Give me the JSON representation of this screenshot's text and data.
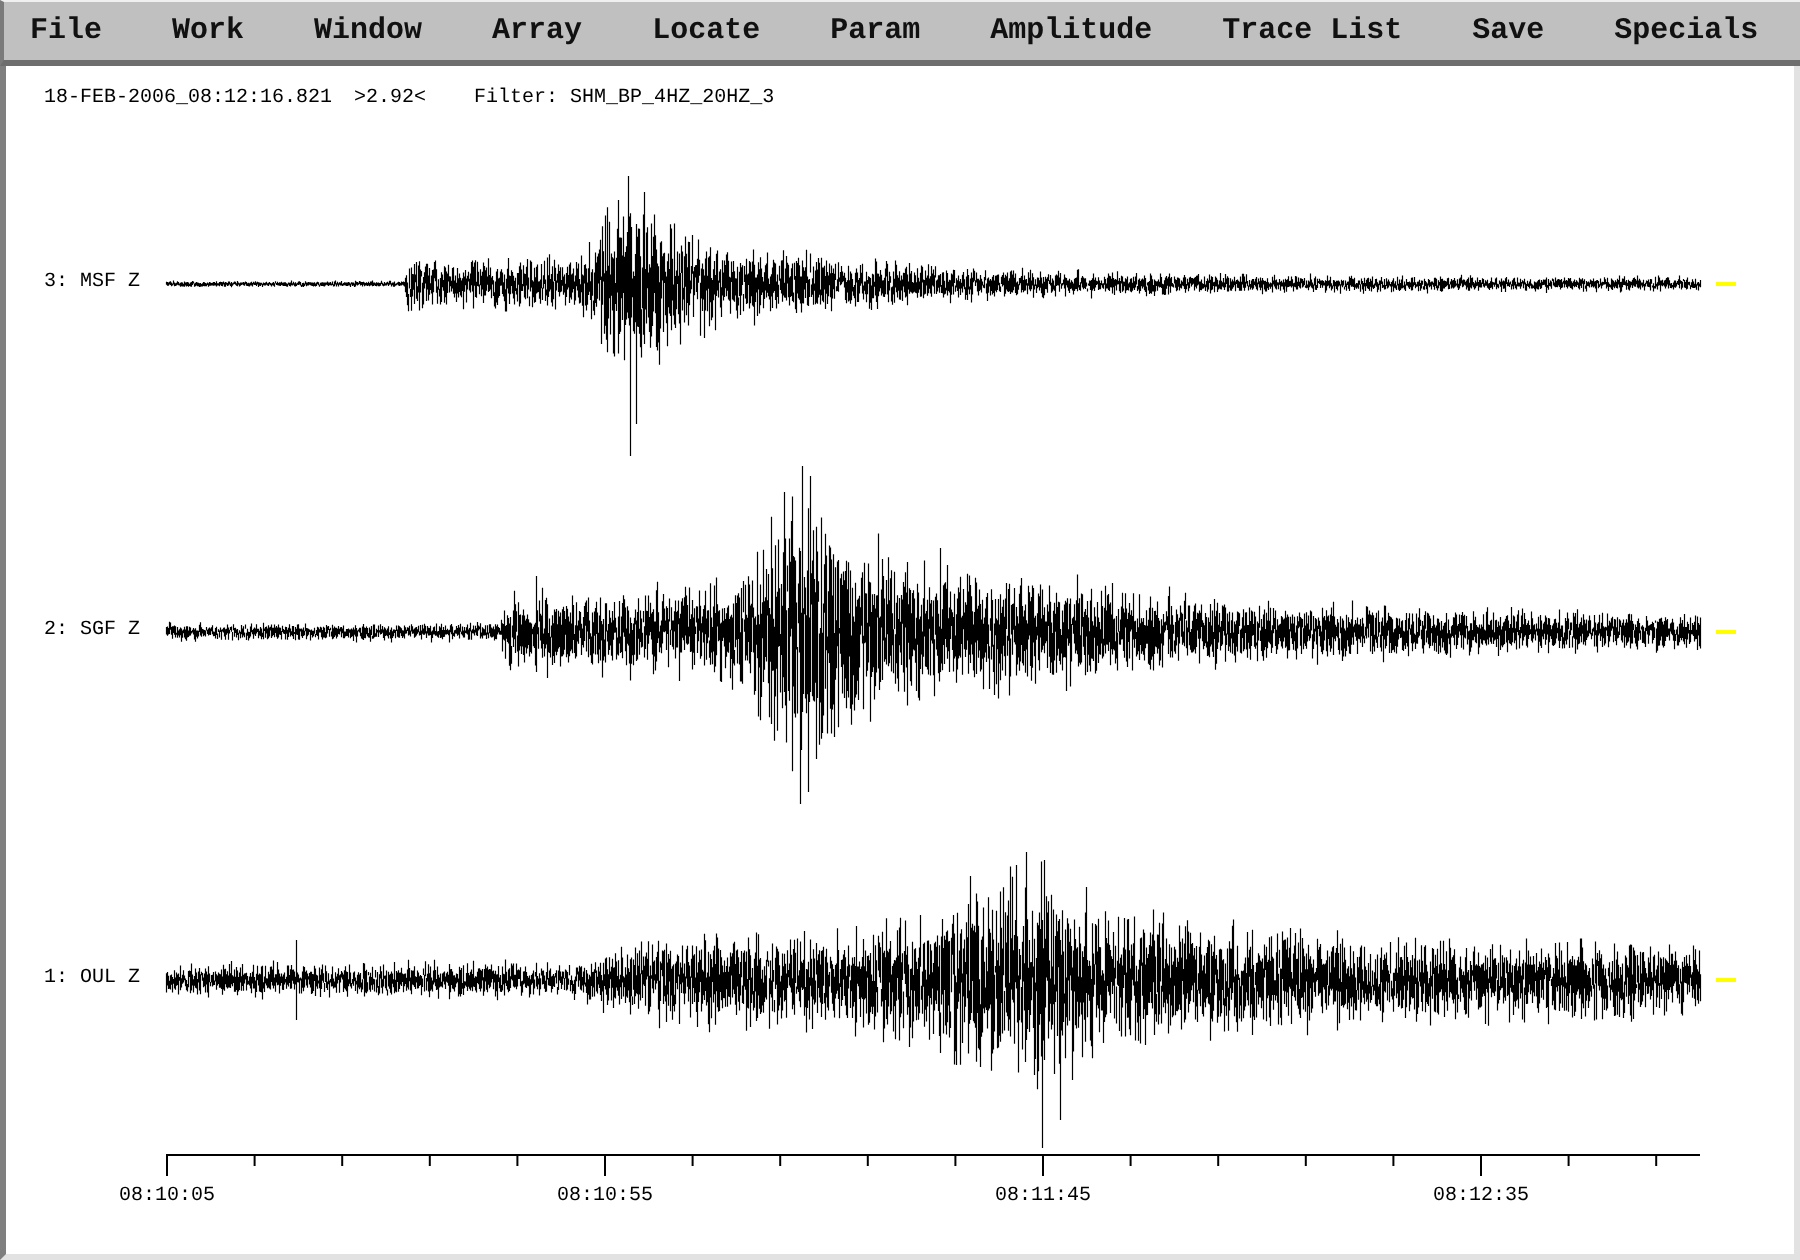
{
  "menu": [
    "File",
    "Work",
    "Window",
    "Array",
    "Locate",
    "Param",
    "Amplitude",
    "Trace List",
    "Save",
    "Specials"
  ],
  "header": {
    "timestamp": "18-FEB-2006_08:12:16.821",
    "amplitude": ">2.92<",
    "filter": "Filter: SHM_BP_4HZ_20HZ_3"
  },
  "traces": [
    {
      "label": "3: MSF Z"
    },
    {
      "label": "2: SGF Z"
    },
    {
      "label": "1: OUL Z"
    }
  ],
  "time_axis": {
    "labels": [
      "08:10:05",
      "08:10:55",
      "08:11:45",
      "08:12:35"
    ]
  }
}
